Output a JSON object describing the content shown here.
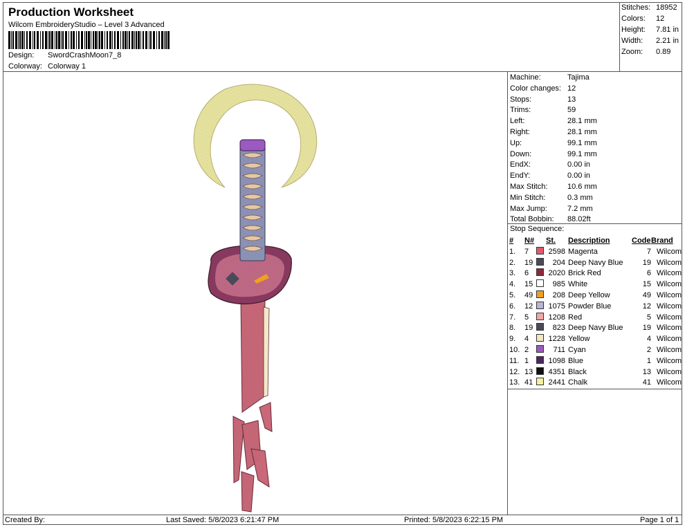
{
  "header": {
    "title": "Production Worksheet",
    "subtitle": "Wilcom EmbroideryStudio – Level 3 Advanced",
    "design_label": "Design:",
    "design_value": "SwordCrashMoon7_8",
    "colorway_label": "Colorway:",
    "colorway_value": "Colorway 1"
  },
  "summary": {
    "stitches_label": "Stitches:",
    "stitches": "18952",
    "colors_label": "Colors:",
    "colors": "12",
    "height_label": "Height:",
    "height": "7.81 in",
    "width_label": "Width:",
    "width": "2.21 in",
    "zoom_label": "Zoom:",
    "zoom": "0.89"
  },
  "machine_info": [
    {
      "k": "Machine:",
      "v": "Tajima"
    },
    {
      "k": "Color changes:",
      "v": "12"
    },
    {
      "k": "Stops:",
      "v": "13"
    },
    {
      "k": "Trims:",
      "v": "59"
    },
    {
      "k": "Left:",
      "v": "28.1 mm"
    },
    {
      "k": "Right:",
      "v": "28.1 mm"
    },
    {
      "k": "Up:",
      "v": "99.1 mm"
    },
    {
      "k": "Down:",
      "v": "99.1 mm"
    },
    {
      "k": "EndX:",
      "v": "0.00 in"
    },
    {
      "k": "EndY:",
      "v": "0.00 in"
    },
    {
      "k": "Max Stitch:",
      "v": "10.6 mm"
    },
    {
      "k": "Min Stitch:",
      "v": "0.3 mm"
    },
    {
      "k": "Max Jump:",
      "v": "7.2 mm"
    },
    {
      "k": "Total Bobbin:",
      "v": "88.02ft"
    }
  ],
  "stop_sequence": {
    "title": "Stop Sequence:",
    "headers": {
      "idx": "#",
      "n": "N#",
      "st": "St.",
      "desc": "Description",
      "code": "Code",
      "brand": "Brand"
    },
    "rows": [
      {
        "idx": "1.",
        "n": "7",
        "color": "#e05a70",
        "st": "2598",
        "desc": "Magenta",
        "code": "7",
        "brand": "Wilcom"
      },
      {
        "idx": "2.",
        "n": "19",
        "color": "#4a4a58",
        "st": "204",
        "desc": "Deep Navy Blue",
        "code": "19",
        "brand": "Wilcom"
      },
      {
        "idx": "3.",
        "n": "6",
        "color": "#8c2a3a",
        "st": "2020",
        "desc": "Brick Red",
        "code": "6",
        "brand": "Wilcom"
      },
      {
        "idx": "4.",
        "n": "15",
        "color": "#ffffff",
        "st": "985",
        "desc": "White",
        "code": "15",
        "brand": "Wilcom"
      },
      {
        "idx": "5.",
        "n": "49",
        "color": "#f0a020",
        "st": "208",
        "desc": "Deep Yellow",
        "code": "49",
        "brand": "Wilcom"
      },
      {
        "idx": "6.",
        "n": "12",
        "color": "#b9b4d8",
        "st": "1075",
        "desc": "Powder Blue",
        "code": "12",
        "brand": "Wilcom"
      },
      {
        "idx": "7.",
        "n": "5",
        "color": "#f0a8a8",
        "st": "1208",
        "desc": "Red",
        "code": "5",
        "brand": "Wilcom"
      },
      {
        "idx": "8.",
        "n": "19",
        "color": "#4a4a58",
        "st": "823",
        "desc": "Deep Navy Blue",
        "code": "19",
        "brand": "Wilcom"
      },
      {
        "idx": "9.",
        "n": "4",
        "color": "#f5e6c8",
        "st": "1228",
        "desc": "Yellow",
        "code": "4",
        "brand": "Wilcom"
      },
      {
        "idx": "10.",
        "n": "2",
        "color": "#9a5ac0",
        "st": "711",
        "desc": "Cyan",
        "code": "2",
        "brand": "Wilcom"
      },
      {
        "idx": "11.",
        "n": "1",
        "color": "#4a2a60",
        "st": "1098",
        "desc": "Blue",
        "code": "1",
        "brand": "Wilcom"
      },
      {
        "idx": "12.",
        "n": "13",
        "color": "#111111",
        "st": "4351",
        "desc": "Black",
        "code": "13",
        "brand": "Wilcom"
      },
      {
        "idx": "13.",
        "n": "41",
        "color": "#f4f0a0",
        "st": "2441",
        "desc": "Chalk",
        "code": "41",
        "brand": "Wilcom"
      }
    ]
  },
  "footer": {
    "created_by": "Created By:",
    "last_saved": "Last Saved: 5/8/2023 6:21:47 PM",
    "printed": "Printed: 5/8/2023 6:22:15 PM",
    "page": "Page 1 of 1"
  },
  "colors": {
    "moon": "#e8e4a0",
    "blade": "#c86878",
    "handle": "#8e94b8",
    "guard": "#8a3a60"
  }
}
